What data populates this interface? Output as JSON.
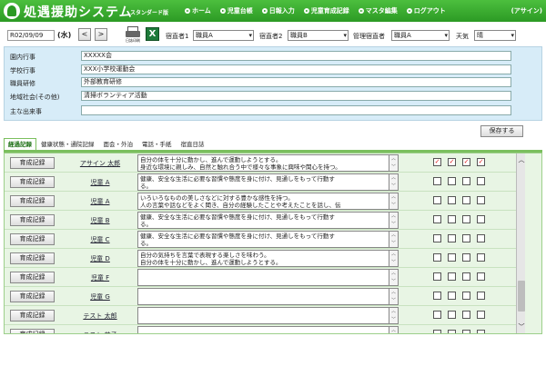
{
  "header": {
    "title": "処遇援助システム",
    "edition": "スタンダード版",
    "nav": [
      "ホーム",
      "児童台帳",
      "日報入力",
      "児童育成記録",
      "マスタ編集",
      "ログアウト"
    ],
    "user": "(アサイン)"
  },
  "toolbar": {
    "date": "R02/09/09",
    "weekday": "(水)",
    "prev_label": "<",
    "next_label": ">",
    "print_label": "日誌印刷",
    "excel_label": "X",
    "staff1_label": "宿直者1",
    "staff1_value": "職員A",
    "staff2_label": "宿直者2",
    "staff2_value": "職員B",
    "manager_label": "管理宿直者",
    "manager_value": "職員A",
    "weather_label": "天気",
    "weather_value": "晴"
  },
  "events": [
    {
      "label": "園内行事",
      "value": "XXXXX会"
    },
    {
      "label": "学校行事",
      "value": "XXX小学校運動会"
    },
    {
      "label": "職員研修",
      "value": "外部教育研修"
    },
    {
      "label": "地域社会(その他)",
      "value": "清掃ボランティア活動"
    },
    {
      "label": "主な出来事",
      "value": ""
    }
  ],
  "save_label": "保存する",
  "tabs": [
    "経過記録",
    "健康状態・通院記録",
    "面会・外泊",
    "電話・手紙",
    "宿直日誌"
  ],
  "record_label": "育成記録",
  "rows": [
    {
      "name": "アサイン 太郎",
      "note1": "自分の体を十分に動かし、進んで運動しようとする。",
      "note2": "身近な環境に親しみ、自然と触れ合う中で様々な事象に興味や関心を持つ。",
      "checks": [
        true,
        true,
        true,
        true
      ]
    },
    {
      "name": "児童 A",
      "note1": "健康、安全な生活に必要な習慣や態度を身に付け、見通しをもって行動す",
      "note2": "る。",
      "checks": [
        false,
        false,
        false,
        false
      ]
    },
    {
      "name": "児童 A",
      "note1": "いろいろなものの美しさなどに対する豊かな感性を持つ。",
      "note2": "人の言葉や話などをよく聞き、自分の経験したことや考えたことを話し、伝",
      "checks": [
        false,
        false,
        false,
        false
      ]
    },
    {
      "name": "児童 B",
      "note1": "健康、安全な生活に必要な習慣や態度を身に付け、見通しをもって行動す",
      "note2": "る。",
      "checks": [
        false,
        false,
        false,
        false
      ]
    },
    {
      "name": "児童 C",
      "note1": "健康、安全な生活に必要な習慣や態度を身に付け、見通しをもって行動す",
      "note2": "る。",
      "checks": [
        false,
        false,
        false,
        false
      ]
    },
    {
      "name": "児童 D",
      "note1": "自分の気持ちを言葉で表現する楽しさを味わう。",
      "note2": "自分の体を十分に動かし、進んで運動しようとする。",
      "checks": [
        false,
        false,
        false,
        false
      ]
    },
    {
      "name": "児童 F",
      "note1": "",
      "note2": "",
      "checks": [
        false,
        false,
        false,
        false
      ]
    },
    {
      "name": "児童 G",
      "note1": "",
      "note2": "",
      "checks": [
        false,
        false,
        false,
        false
      ]
    },
    {
      "name": "テスト 太郎",
      "note1": "",
      "note2": "",
      "checks": [
        false,
        false,
        false,
        false
      ]
    },
    {
      "name": "テスト 花子",
      "note1": "",
      "note2": "",
      "checks": [
        false,
        false,
        false,
        false
      ]
    }
  ]
}
